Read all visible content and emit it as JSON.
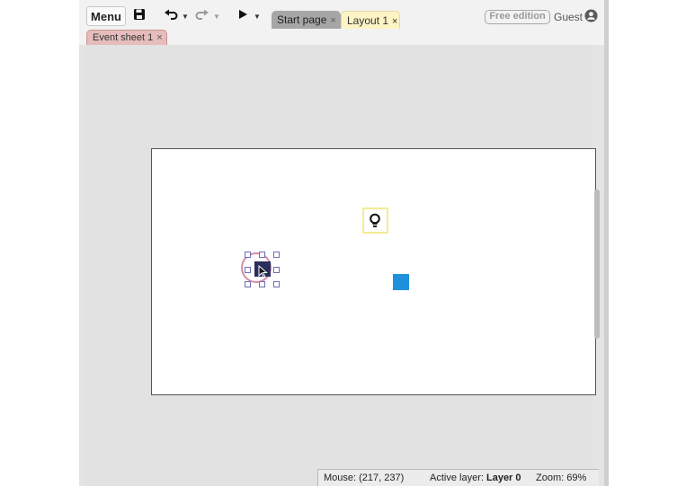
{
  "toolbar": {
    "menu_label": "Menu",
    "save_icon": "save-icon",
    "undo_icon": "undo-icon",
    "redo_icon": "redo-icon",
    "run_icon": "play-icon"
  },
  "tabs": [
    {
      "label": "Start page",
      "close": "×",
      "active": false
    },
    {
      "label": "Layout 1",
      "close": "×",
      "active": true
    }
  ],
  "subtabs": [
    {
      "label": "Event sheet 1",
      "close": "×"
    }
  ],
  "account": {
    "edition_badge": "Free edition",
    "user_label": "Guest",
    "user_icon": "user-circle-icon"
  },
  "layout_objects": [
    {
      "name": "lightbulb-icon",
      "color": "#f3ec95"
    },
    {
      "name": "player-sprite",
      "color": "#2a2e5c",
      "selected": true
    },
    {
      "name": "blue-square",
      "color": "#1e90dc"
    }
  ],
  "status": {
    "mouse": "Mouse: (217, 237)",
    "active_layer_label": "Active layer:",
    "active_layer_value": "Layer 0",
    "zoom": "Zoom: 69%"
  },
  "colors": {
    "event_tab": "#e6bcbc",
    "layout_tab": "#fdf3c4",
    "start_tab": "#a6a6a6",
    "selection_circle": "#d98aa3",
    "accent_blue": "#1e90dc"
  }
}
